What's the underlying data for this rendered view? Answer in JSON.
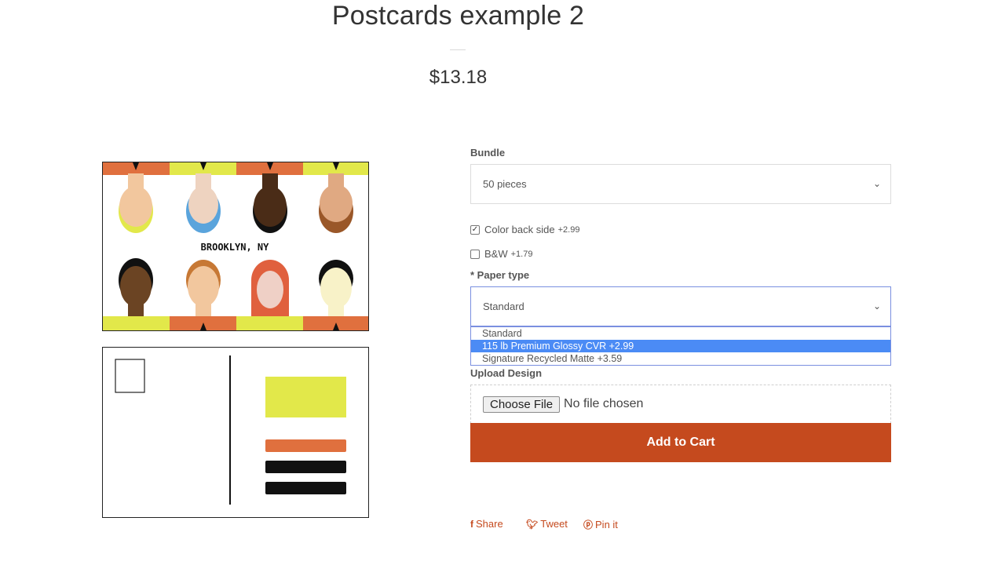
{
  "product": {
    "title": "Postcards example 2",
    "price": "$13.18"
  },
  "artwork": {
    "front_caption": "BROOKLYN, NY",
    "colors": {
      "orange": "#e0703e",
      "yellow": "#e2e84a",
      "black": "#111111"
    }
  },
  "options": {
    "bundle_label": "Bundle",
    "bundle_value": "50 pieces",
    "color_back_label": "Color back side",
    "color_back_price": "+2.99",
    "color_back_checked": "✓",
    "bw_label": "B&W",
    "bw_price": "+1.79",
    "paper_label": "* Paper type",
    "paper_value": "Standard",
    "paper_options": [
      "Standard",
      "115 lb Premium Glossy CVR +2.99",
      "Signature Recycled Matte +3.59"
    ],
    "upload_label": "Upload Design",
    "choose_file": "Choose File",
    "no_file": "No file chosen"
  },
  "actions": {
    "add_to_cart": "Add to Cart",
    "share": "Share",
    "tweet": "Tweet",
    "pin": "Pin it"
  },
  "icons": {
    "chevron": "chevron-down-icon",
    "facebook": "facebook-icon",
    "twitter": "twitter-icon",
    "pinterest": "pinterest-icon"
  },
  "theme": {
    "accent": "#c54a1e",
    "highlight": "#4b8bf5"
  }
}
